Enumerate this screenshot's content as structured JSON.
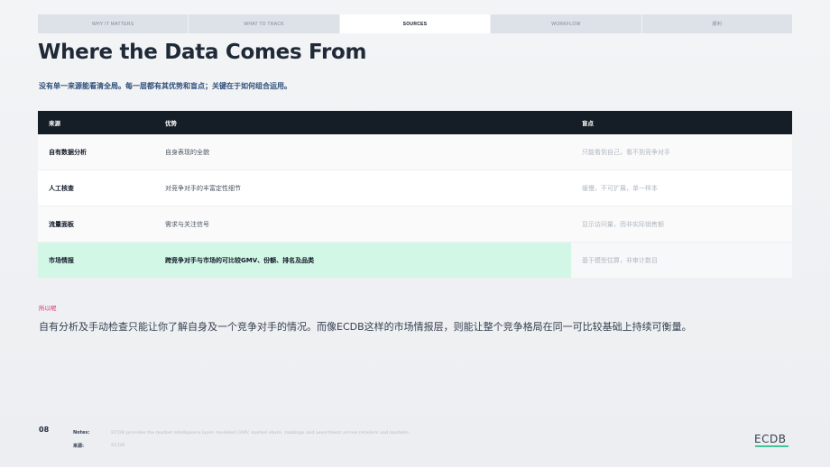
{
  "tabs": [
    {
      "label": "WHY IT MATTERS"
    },
    {
      "label": "WHAT TO TRACK"
    },
    {
      "label": "SOURCES"
    },
    {
      "label": "WORKFLOW"
    },
    {
      "label": "顺利"
    }
  ],
  "active_tab": "SOURCES",
  "title": "Where the Data Comes From",
  "subtitle": "没有单一来源能看清全局。每一层都有其优势和盲点；关键在于如何组合运用。",
  "table": {
    "headers": [
      "来源",
      "优势",
      "盲点"
    ],
    "rows": [
      {
        "source": "自有数据分析",
        "strength": "自身表现的全貌",
        "blindspot": "只能看到自己，看不到竞争对手"
      },
      {
        "source": "人工核查",
        "strength": "对竞争对手的丰富定性细节",
        "blindspot": "缓慢，不可扩展，单一样本"
      },
      {
        "source": "流量面板",
        "strength": "需求与关注信号",
        "blindspot": "显示访问量，而非实际销售额"
      },
      {
        "source": "市场情报",
        "strength": "跨竞争对手与市场的可比较GMV、份额、排名及品类",
        "blindspot": "基于模型估算，非审计数目"
      }
    ]
  },
  "sowhat": {
    "label": "所以呢",
    "text": "自有分析及手动检查只能让你了解自身及一个竞争对手的情况。而像ECDB这样的市场情报层，则能让整个竞争格局在同一可比较基础上持续可衡量。"
  },
  "footer": {
    "page": "08",
    "notes_label": "Notes:",
    "notes_text": "ECDB provides the market intelligence layer: modeled GMV, market share, rankings and assortment across retailers and markets.",
    "source_label": "来源:",
    "source_text": "ECDB",
    "logo": "ECDB"
  },
  "colors": {
    "header_bg": "#151d26",
    "highlight": "#d2f7e6",
    "accent_pink": "#d4336b",
    "logo_accent": "#3fc79a"
  }
}
